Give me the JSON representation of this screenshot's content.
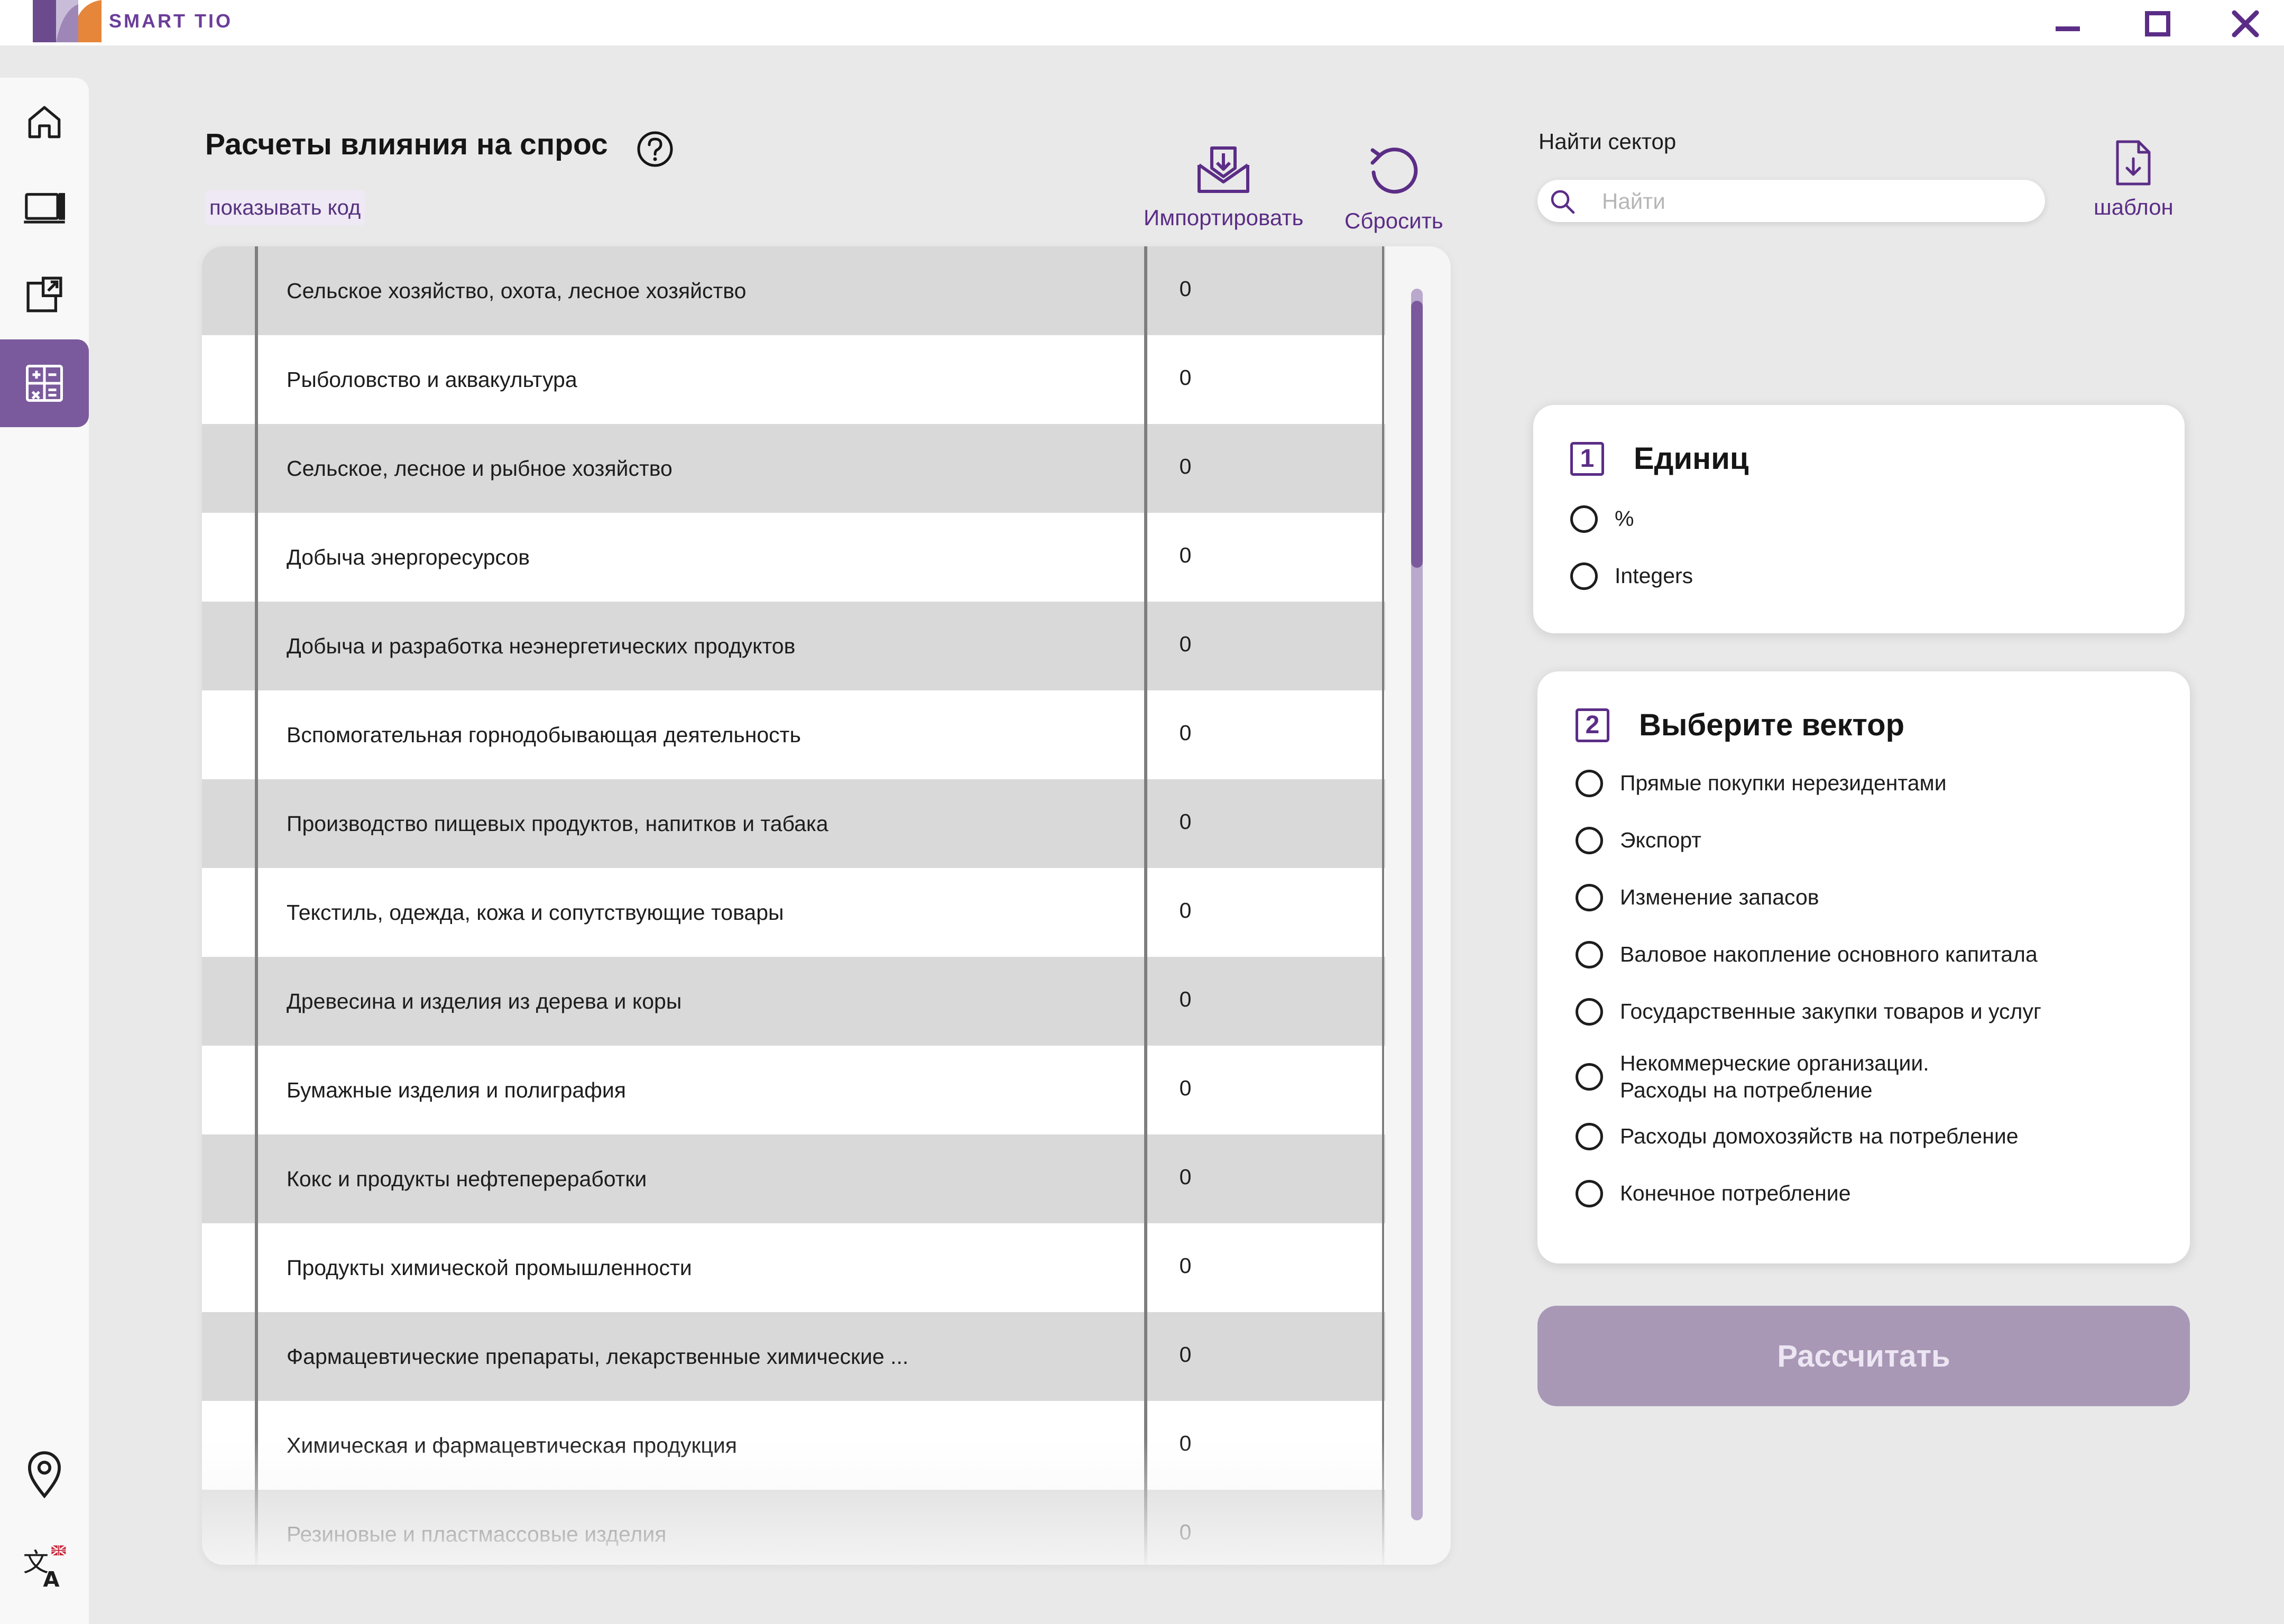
{
  "app": {
    "name": "SMART TIO"
  },
  "colors": {
    "accent": "#5b2d86",
    "sidebar_active": "#7a5a9c",
    "row_shade": "#d9d9d9",
    "calc_button": "#a898b6"
  },
  "window_controls": [
    "minimize-icon",
    "maximize-icon",
    "close-icon"
  ],
  "sidebar": {
    "items": [
      {
        "icon": "home-icon"
      },
      {
        "icon": "laptop-icon"
      },
      {
        "icon": "external-window-icon"
      },
      {
        "icon": "calculator-icon",
        "active": true
      }
    ],
    "bottom_items": [
      {
        "icon": "location-pin-icon"
      },
      {
        "icon": "translate-icon"
      }
    ]
  },
  "page": {
    "title": "Расчеты влияния на спрос",
    "show_code_label": "показывать код",
    "import_label": "Импортировать",
    "reset_label": "Сбросить"
  },
  "table": {
    "rows": [
      {
        "name": "Сельское хозяйство, охота, лесное хозяйство",
        "value": "0"
      },
      {
        "name": "Рыболовство и аквакультура",
        "value": "0"
      },
      {
        "name": "Сельское, лесное и рыбное хозяйство",
        "value": "0"
      },
      {
        "name": "Добыча  энергоресурсов",
        "value": "0"
      },
      {
        "name": "Добыча и разработка неэнергетических продуктов",
        "value": "0"
      },
      {
        "name": "Вспомогательная горнодобывающая деятельность",
        "value": "0"
      },
      {
        "name": "Производство пищевых продуктов, напитков и табака",
        "value": "0"
      },
      {
        "name": "Текстиль, одежда, кожа и сопутствующие товары",
        "value": "0"
      },
      {
        "name": "Древесина и изделия из дерева и коры",
        "value": "0"
      },
      {
        "name": "Бумажные изделия и полиграфия",
        "value": "0"
      },
      {
        "name": "Кокс и продукты нефтепереработки",
        "value": "0"
      },
      {
        "name": "Продукты химической промышленности",
        "value": "0"
      },
      {
        "name": "Фармацевтические препараты, лекарственные химические ...",
        "value": "0"
      },
      {
        "name": "Химическая и фармацевтическая продукция",
        "value": "0"
      },
      {
        "name": "Резиновые и пластмассовые изделия",
        "value": "0"
      }
    ]
  },
  "search": {
    "label": "Найти сектор",
    "placeholder": "Найти",
    "value": ""
  },
  "template_label": "шаблон",
  "units": {
    "number": "1",
    "title": "Единиц",
    "options": [
      "%",
      "Integers"
    ]
  },
  "vector": {
    "number": "2",
    "title": "Выберите вектор",
    "options": [
      "Прямые покупки нерезидентами",
      "Экспорт",
      "Изменение запасов",
      "Валовое накопление основного капитала",
      "Государственные закупки товаров и услуг",
      "Некоммерческие организации.\nРасходы на потребление",
      "Расходы домохозяйств на потребление",
      "Конечное потребление"
    ]
  },
  "calculate_label": "Рассчитать"
}
